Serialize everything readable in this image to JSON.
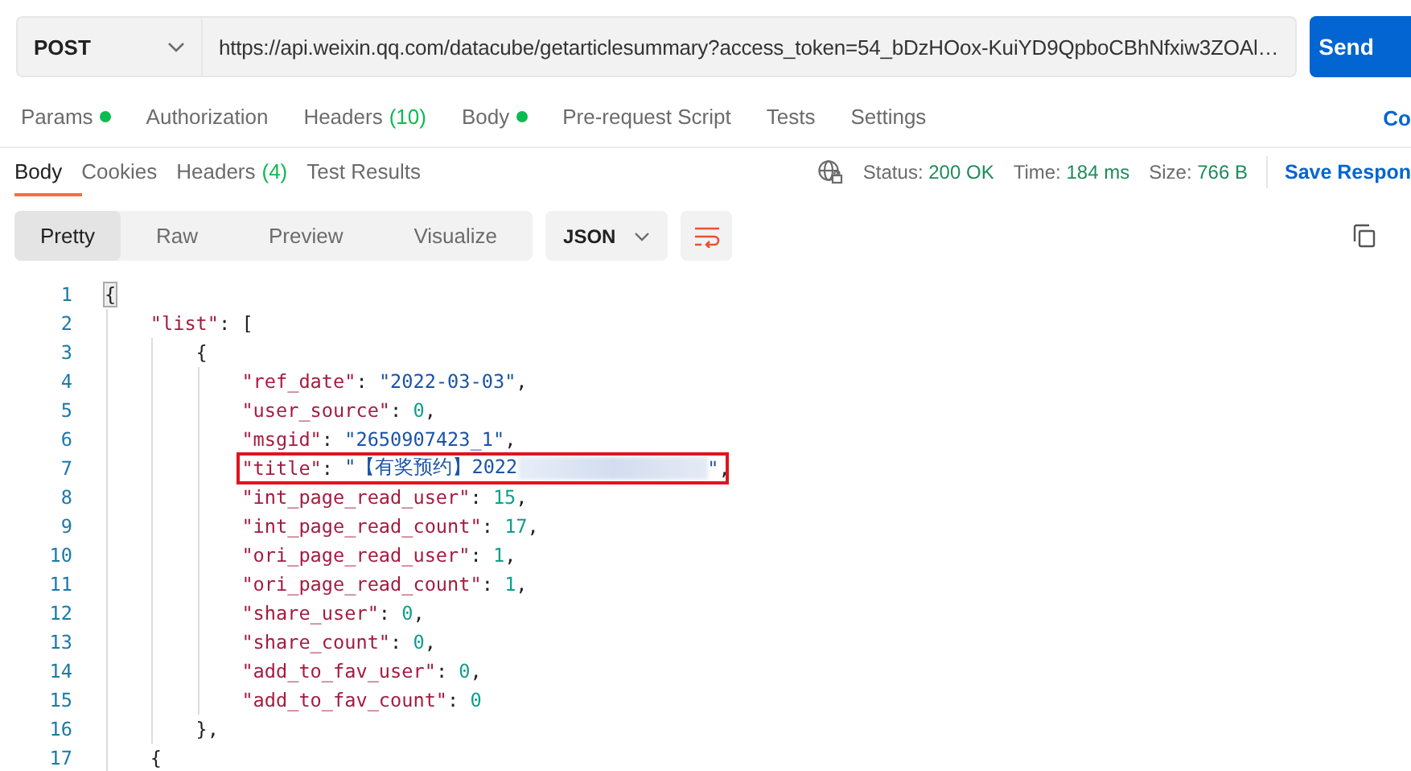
{
  "request": {
    "method": "POST",
    "url": "https://api.weixin.qq.com/datacube/getarticlesummary?access_token=54_bDzHOox-KuiYD9QpboCBhNfxiw3ZOAl…",
    "send": "Send"
  },
  "request_tabs": [
    {
      "label": "Params",
      "dot": true,
      "selected": false
    },
    {
      "label": "Authorization",
      "dot": false,
      "selected": false
    },
    {
      "label": "Headers",
      "count": "(10)",
      "dot": false,
      "selected": false
    },
    {
      "label": "Body",
      "dot": true,
      "selected": false
    },
    {
      "label": "Pre-request Script",
      "dot": false,
      "selected": false
    },
    {
      "label": "Tests",
      "dot": false,
      "selected": false
    },
    {
      "label": "Settings",
      "dot": false,
      "selected": false
    }
  ],
  "request_link": "Co",
  "response_tabs": [
    {
      "label": "Body",
      "selected": true
    },
    {
      "label": "Cookies",
      "selected": false
    },
    {
      "label": "Headers",
      "count": "(4)",
      "selected": false
    },
    {
      "label": "Test Results",
      "selected": false
    }
  ],
  "status": [
    {
      "label": "Status:",
      "value": "200 OK"
    },
    {
      "label": "Time:",
      "value": "184 ms"
    },
    {
      "label": "Size:",
      "value": "766 B"
    }
  ],
  "save_response": "Save Respon",
  "view_modes": [
    {
      "label": "Pretty",
      "selected": true
    },
    {
      "label": "Raw",
      "selected": false
    },
    {
      "label": "Preview",
      "selected": false
    },
    {
      "label": "Visualize",
      "selected": false
    }
  ],
  "format": "JSON",
  "code_lines": [
    {
      "number": "1",
      "highlighted": false,
      "tokens": [
        {
          "kind": "bracket-match",
          "text": "{"
        }
      ]
    },
    {
      "number": "2",
      "highlighted": false,
      "tokens": [
        {
          "kind": "key",
          "text": "\"list\""
        },
        {
          "kind": "punct",
          "text": ": ["
        }
      ]
    },
    {
      "number": "3",
      "highlighted": false,
      "tokens": [
        {
          "kind": "punct",
          "text": "{"
        }
      ]
    },
    {
      "number": "4",
      "highlighted": false,
      "tokens": [
        {
          "kind": "key",
          "text": "\"ref_date\""
        },
        {
          "kind": "punct",
          "text": ": "
        },
        {
          "kind": "string",
          "text": "\"2022-03-03\""
        },
        {
          "kind": "punct",
          "text": ","
        }
      ]
    },
    {
      "number": "5",
      "highlighted": false,
      "tokens": [
        {
          "kind": "key",
          "text": "\"user_source\""
        },
        {
          "kind": "punct",
          "text": ": "
        },
        {
          "kind": "number",
          "text": "0"
        },
        {
          "kind": "punct",
          "text": ","
        }
      ]
    },
    {
      "number": "6",
      "highlighted": false,
      "tokens": [
        {
          "kind": "key",
          "text": "\"msgid\""
        },
        {
          "kind": "punct",
          "text": ": "
        },
        {
          "kind": "string",
          "text": "\"2650907423_1\""
        },
        {
          "kind": "punct",
          "text": ","
        }
      ]
    },
    {
      "number": "7",
      "highlighted": true,
      "tokens": [
        {
          "kind": "key",
          "text": "\"title\""
        },
        {
          "kind": "punct",
          "text": ": "
        },
        {
          "kind": "string",
          "text": "\"【有奖预约】2022"
        },
        {
          "kind": "redacted"
        },
        {
          "kind": "string",
          "text": "\""
        },
        {
          "kind": "punct",
          "text": ","
        }
      ]
    },
    {
      "number": "8",
      "highlighted": false,
      "tokens": [
        {
          "kind": "key",
          "text": "\"int_page_read_user\""
        },
        {
          "kind": "punct",
          "text": ": "
        },
        {
          "kind": "number",
          "text": "15"
        },
        {
          "kind": "punct",
          "text": ","
        }
      ]
    },
    {
      "number": "9",
      "highlighted": false,
      "tokens": [
        {
          "kind": "key",
          "text": "\"int_page_read_count\""
        },
        {
          "kind": "punct",
          "text": ": "
        },
        {
          "kind": "number",
          "text": "17"
        },
        {
          "kind": "punct",
          "text": ","
        }
      ]
    },
    {
      "number": "10",
      "highlighted": false,
      "tokens": [
        {
          "kind": "key",
          "text": "\"ori_page_read_user\""
        },
        {
          "kind": "punct",
          "text": ": "
        },
        {
          "kind": "number",
          "text": "1"
        },
        {
          "kind": "punct",
          "text": ","
        }
      ]
    },
    {
      "number": "11",
      "highlighted": false,
      "tokens": [
        {
          "kind": "key",
          "text": "\"ori_page_read_count\""
        },
        {
          "kind": "punct",
          "text": ": "
        },
        {
          "kind": "number",
          "text": "1"
        },
        {
          "kind": "punct",
          "text": ","
        }
      ]
    },
    {
      "number": "12",
      "highlighted": false,
      "tokens": [
        {
          "kind": "key",
          "text": "\"share_user\""
        },
        {
          "kind": "punct",
          "text": ": "
        },
        {
          "kind": "number",
          "text": "0"
        },
        {
          "kind": "punct",
          "text": ","
        }
      ]
    },
    {
      "number": "13",
      "highlighted": false,
      "tokens": [
        {
          "kind": "key",
          "text": "\"share_count\""
        },
        {
          "kind": "punct",
          "text": ": "
        },
        {
          "kind": "number",
          "text": "0"
        },
        {
          "kind": "punct",
          "text": ","
        }
      ]
    },
    {
      "number": "14",
      "highlighted": false,
      "tokens": [
        {
          "kind": "key",
          "text": "\"add_to_fav_user\""
        },
        {
          "kind": "punct",
          "text": ": "
        },
        {
          "kind": "number",
          "text": "0"
        },
        {
          "kind": "punct",
          "text": ","
        }
      ]
    },
    {
      "number": "15",
      "highlighted": false,
      "tokens": [
        {
          "kind": "key",
          "text": "\"add_to_fav_count\""
        },
        {
          "kind": "punct",
          "text": ": "
        },
        {
          "kind": "number",
          "text": "0"
        }
      ]
    },
    {
      "number": "16",
      "highlighted": false,
      "tokens": [
        {
          "kind": "punct",
          "text": "},"
        }
      ]
    },
    {
      "number": "17",
      "highlighted": false,
      "tokens": [
        {
          "kind": "punct",
          "text": "{"
        }
      ]
    }
  ]
}
